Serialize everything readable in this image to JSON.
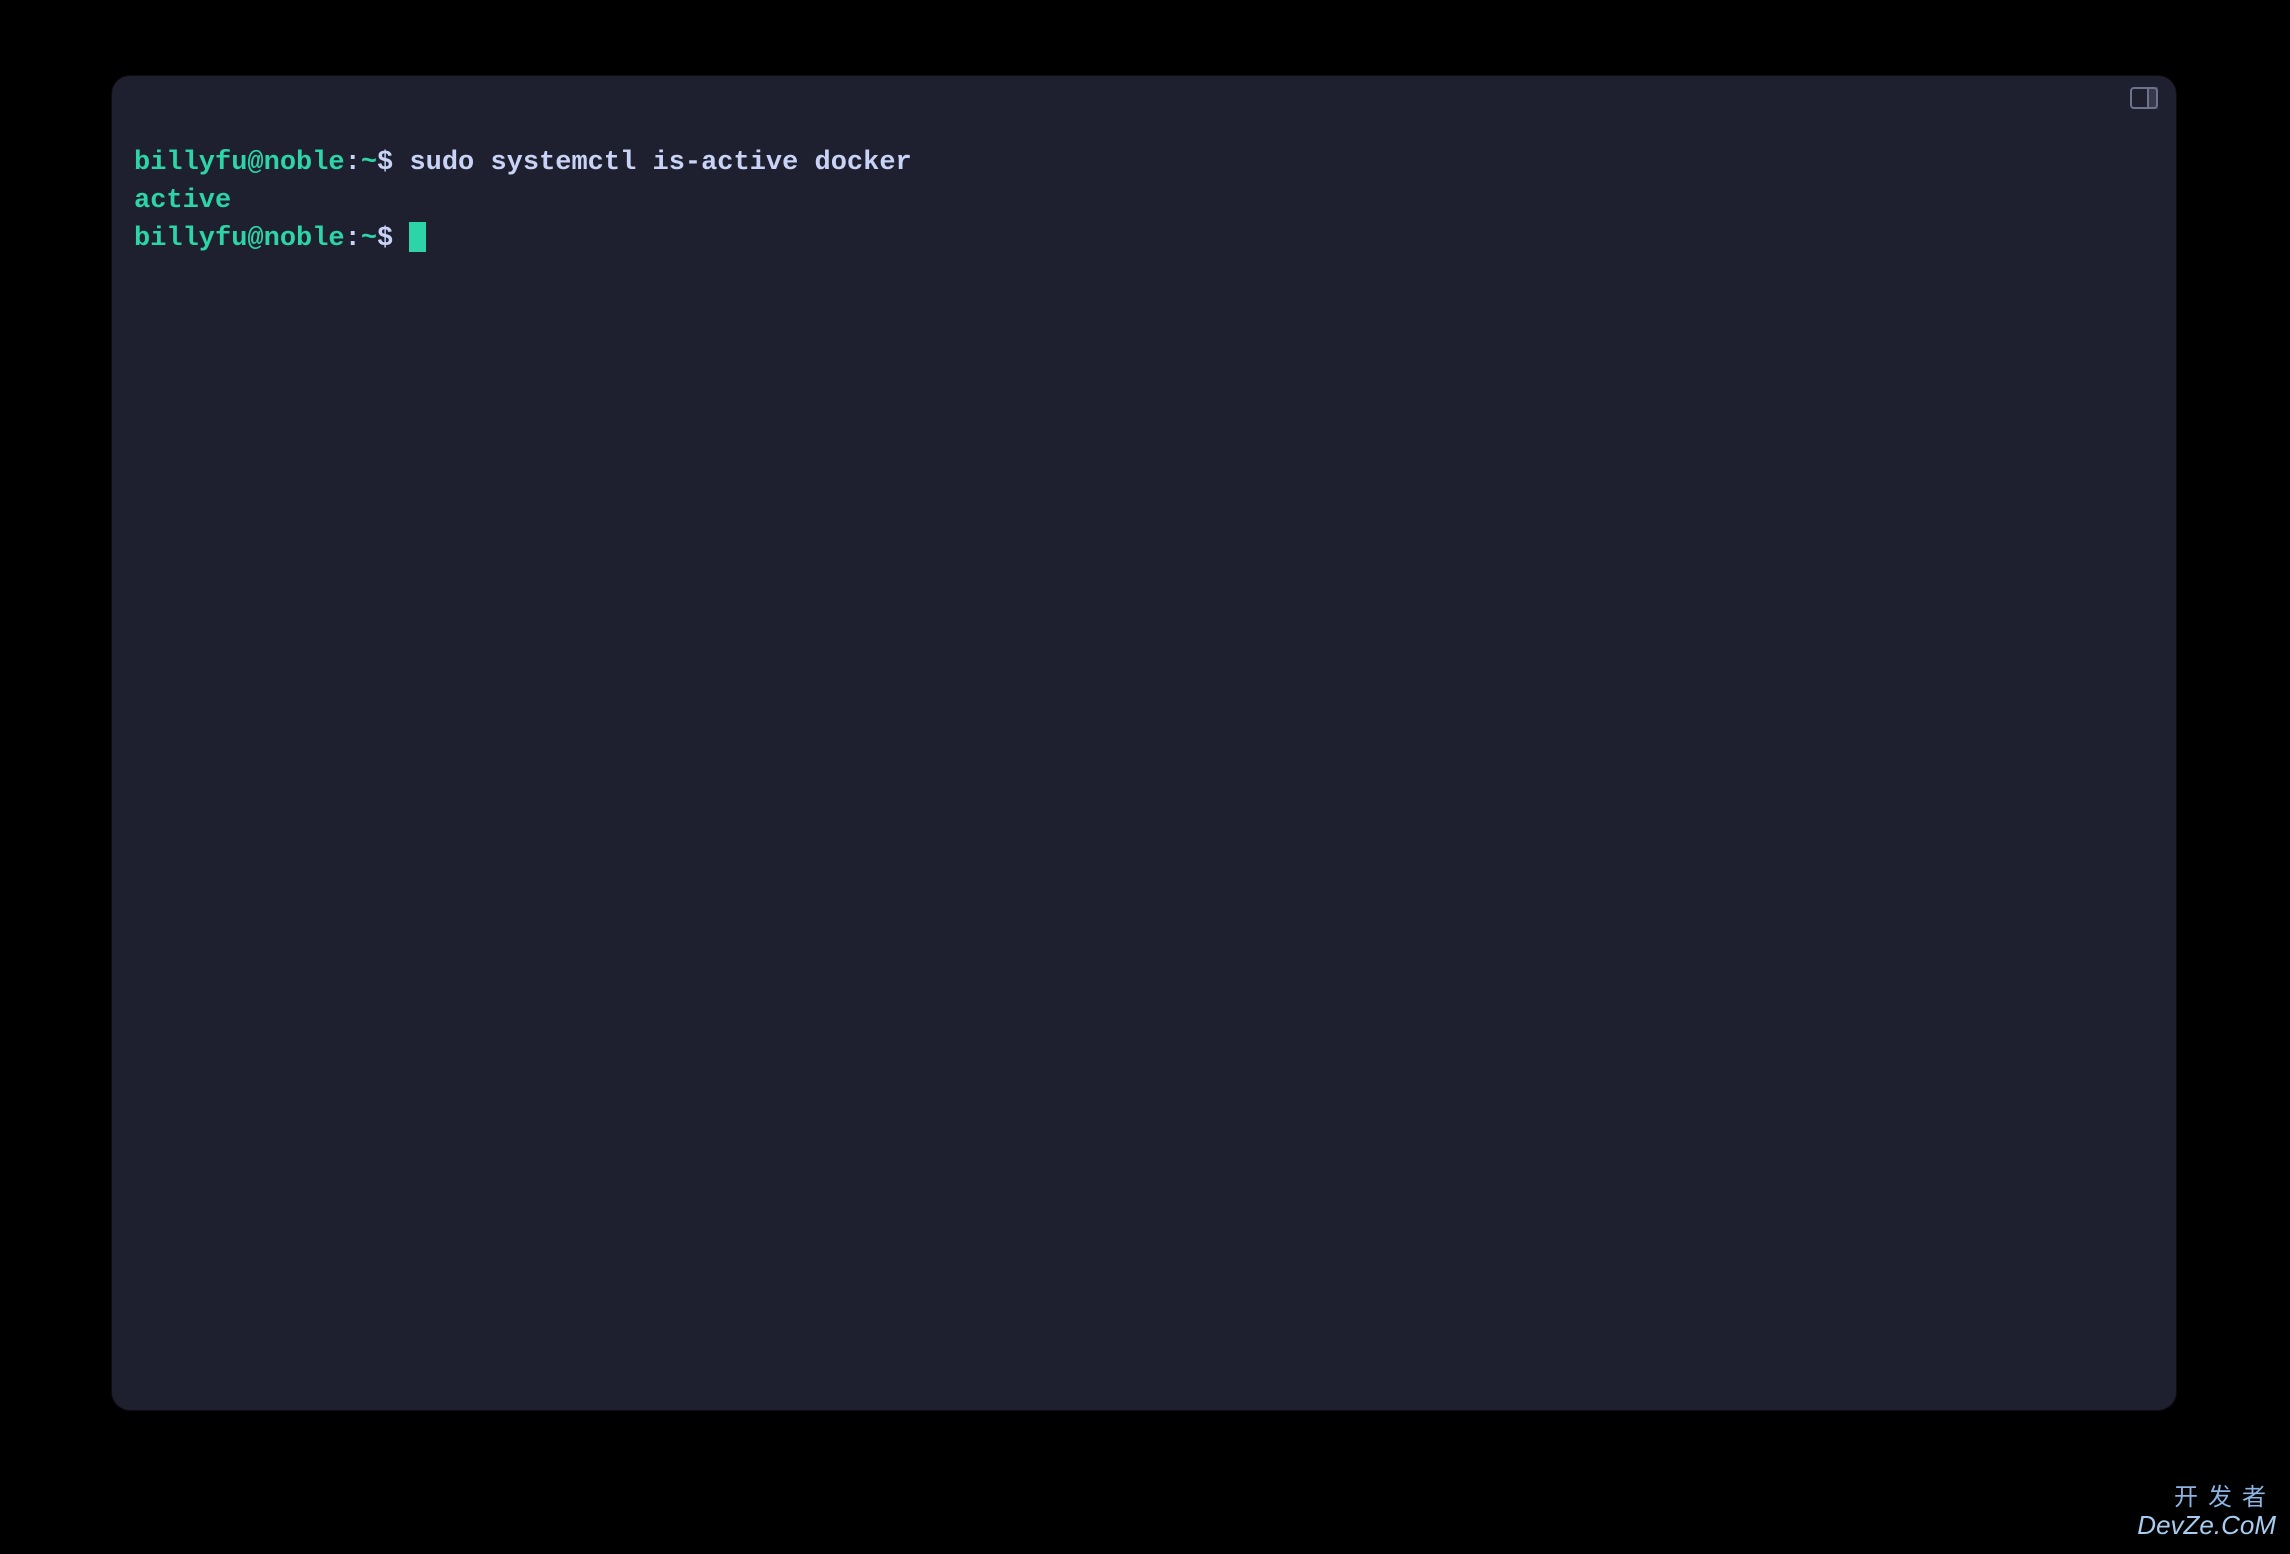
{
  "terminal": {
    "lines": [
      {
        "type": "prompt_command",
        "user": "billyfu@noble",
        "path": "~",
        "symbol": "$",
        "command": "sudo systemctl is-active docker"
      },
      {
        "type": "output",
        "text": "active"
      },
      {
        "type": "prompt_cursor",
        "user": "billyfu@noble",
        "path": "~",
        "symbol": "$"
      }
    ]
  },
  "watermark": {
    "line1": "开发者",
    "line2": "DevZe.CoM"
  },
  "colors": {
    "background_outer": "#000000",
    "background_terminal": "#1e2030",
    "prompt_green": "#2dd4a7",
    "text_default": "#c8d3f5",
    "watermark": "#8db4e2"
  }
}
